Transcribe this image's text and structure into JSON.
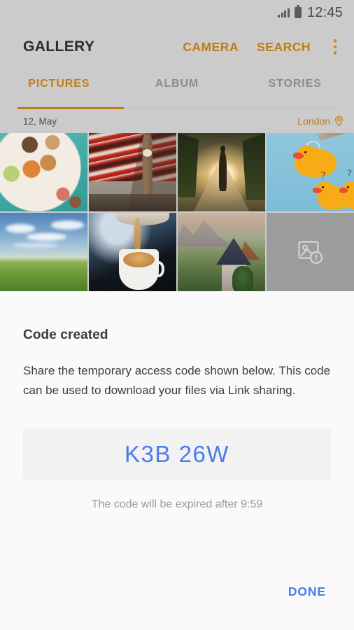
{
  "status_bar": {
    "clock": "12:45",
    "signal_icon": "signal-bars-icon",
    "battery_icon": "battery-full-icon"
  },
  "app_bar": {
    "title": "GALLERY",
    "actions": [
      {
        "label": "CAMERA",
        "name": "camera-button"
      },
      {
        "label": "SEARCH",
        "name": "search-button"
      }
    ],
    "overflow_icon": "more-vertical-icon",
    "accent_color": "#c07d14"
  },
  "tabs": {
    "items": [
      {
        "label": "PICTURES",
        "active": true
      },
      {
        "label": "ALBUM",
        "active": false
      },
      {
        "label": "STORIES",
        "active": false
      }
    ],
    "indicator_color": "#c07d14"
  },
  "meta_row": {
    "date": "12, May",
    "location": "London",
    "location_icon": "location-pin-icon"
  },
  "gallery": {
    "tiles": [
      {
        "name": "photo-macarons",
        "alt": "Macarons on a plate"
      },
      {
        "name": "photo-big-ben",
        "alt": "Big Ben with red bus motion blur"
      },
      {
        "name": "photo-runner",
        "alt": "Runner on a sunlit path"
      },
      {
        "name": "photo-rubber-ducks",
        "alt": "Yellow rubber ducks"
      },
      {
        "name": "photo-green-field",
        "alt": "Green field under clouds"
      },
      {
        "name": "photo-coffee",
        "alt": "Coffee being poured into a cup"
      },
      {
        "name": "photo-alpine-house",
        "alt": "House in an alpine valley"
      },
      {
        "name": "photo-unavailable",
        "alt": "Image unavailable",
        "placeholder": true,
        "icon": "broken-image-icon"
      }
    ]
  },
  "dialog": {
    "title": "Code created",
    "body": "Share the temporary access code shown below. This code can be used to download your files via Link sharing.",
    "code": "K3B 26W",
    "code_color": "#4a7bef",
    "expiry": "The code will be expired after 9:59",
    "done_label": "DONE"
  }
}
